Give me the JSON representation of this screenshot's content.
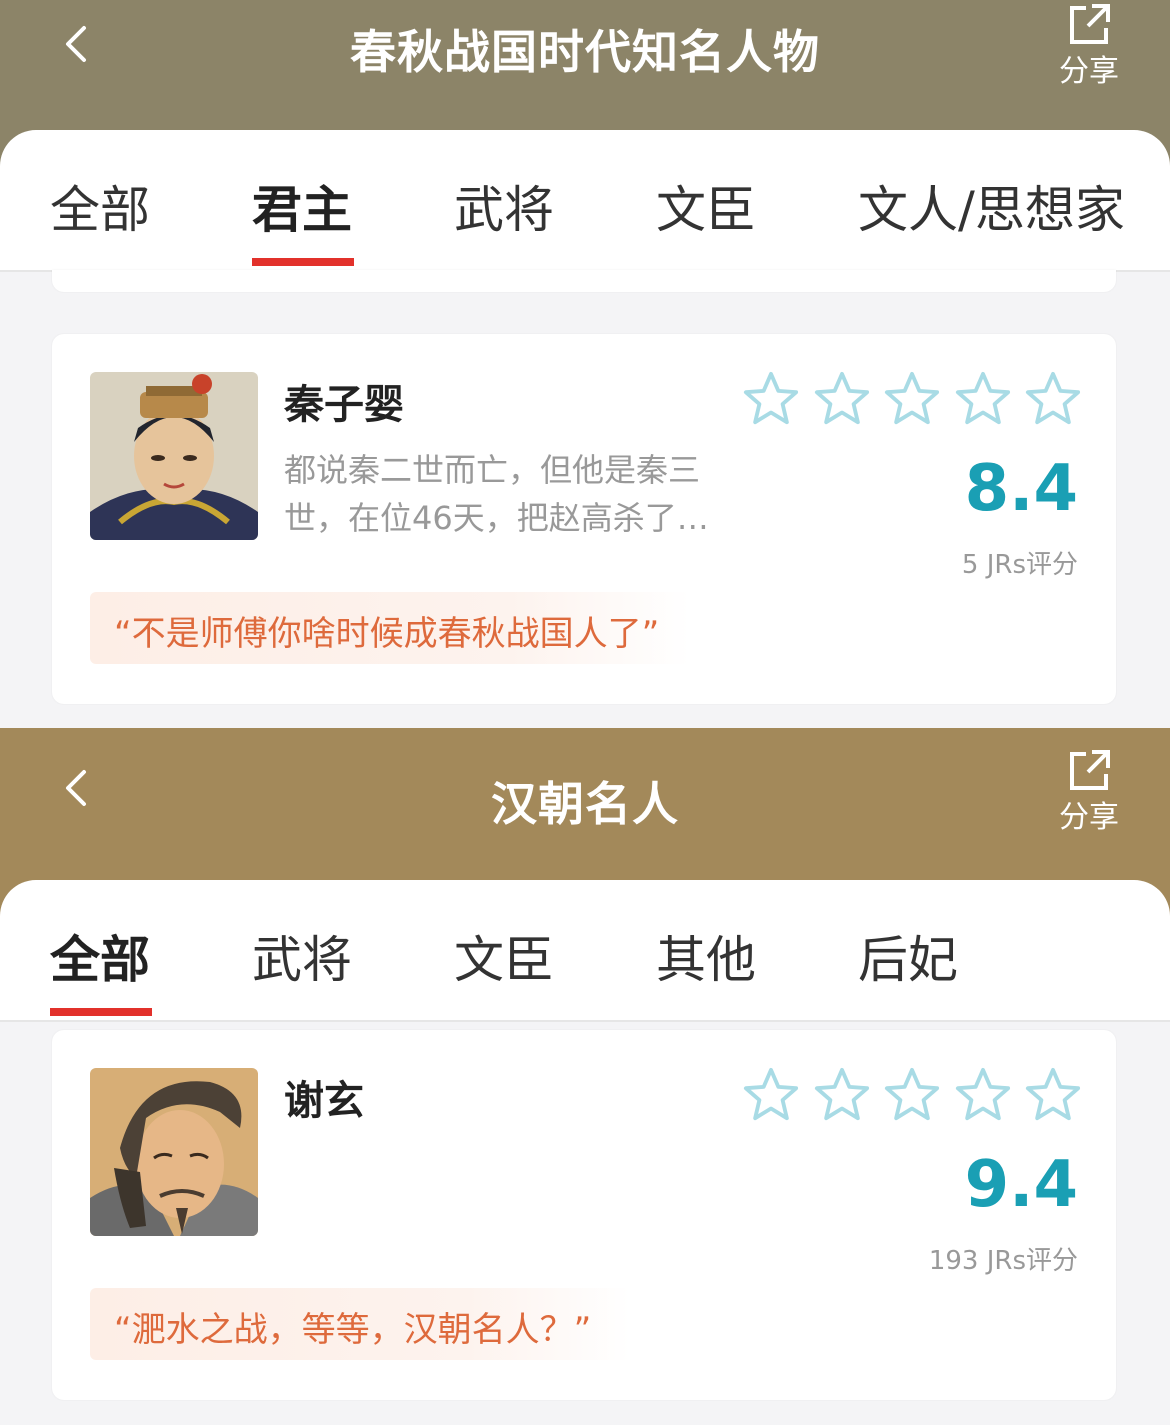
{
  "screen1": {
    "header": {
      "title": "春秋战国时代知名人物",
      "share_label": "分享",
      "bg_color": "#8c8468"
    },
    "tabs": [
      {
        "label": "全部",
        "active": false
      },
      {
        "label": "君主",
        "active": true
      },
      {
        "label": "武将",
        "active": false
      },
      {
        "label": "文臣",
        "active": false
      },
      {
        "label": "文人/思想家",
        "active": false
      }
    ],
    "card": {
      "name": "秦子婴",
      "description": "都说秦二世而亡，但他是秦三世，在位46天，把赵高杀了…",
      "rating_stars": 5,
      "stars_filled": 0,
      "score": "8.4",
      "raters": "5 JRs评分",
      "quote": "“不是师傅你啥时候成春秋战国人了”"
    }
  },
  "screen2": {
    "header": {
      "title": "汉朝名人",
      "share_label": "分享",
      "bg_color": "#a3895a"
    },
    "tabs": [
      {
        "label": "全部",
        "active": true
      },
      {
        "label": "武将",
        "active": false
      },
      {
        "label": "文臣",
        "active": false
      },
      {
        "label": "其他",
        "active": false
      },
      {
        "label": "后妃",
        "active": false
      }
    ],
    "card": {
      "name": "谢玄",
      "description": "",
      "rating_stars": 5,
      "stars_filled": 0,
      "score": "9.4",
      "raters": "193 JRs评分",
      "quote": "“淝水之战，等等，汉朝名人？”"
    }
  },
  "colors": {
    "accent_tab": "#e2312b",
    "score": "#1a9fb4",
    "star_outline": "#a8dbe5",
    "quote_text": "#de6a3c"
  },
  "icons": [
    "back-chevron-icon",
    "share-external-icon",
    "star-outline-icon"
  ]
}
